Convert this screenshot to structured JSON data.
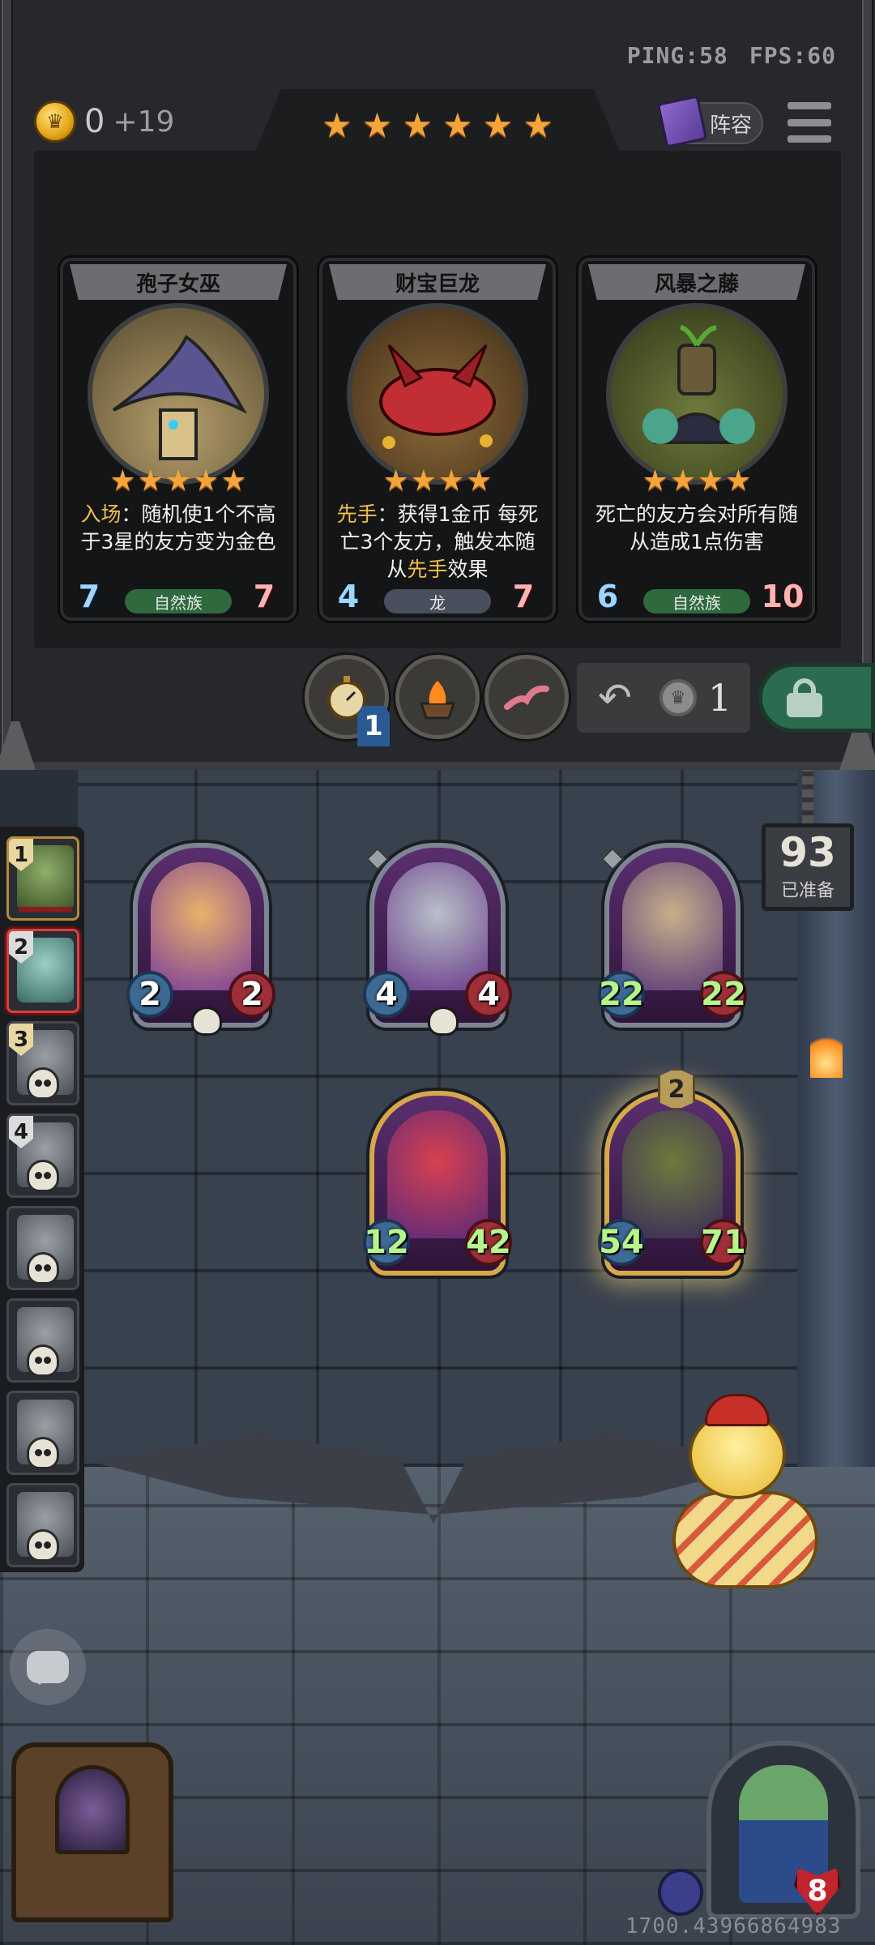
{
  "status": {
    "ping": "PING:58",
    "fps": "FPS:60"
  },
  "gold": {
    "value": "0",
    "income": "+19"
  },
  "tavern_tier_stars": 6,
  "buttons": {
    "lineup": "阵容"
  },
  "shop_cards": [
    {
      "name": "孢子女巫",
      "stars": 5,
      "desc_prefix": "入场",
      "desc_body": "：随机使1个不高于3星的友方变为金色",
      "race": "自然族",
      "attack": "7",
      "health": "7"
    },
    {
      "name": "财宝巨龙",
      "stars": 4,
      "desc_prefix": "先手",
      "desc_body": "：获得1金币 每死亡3个友方，触发本随从",
      "desc_suffix_hl": "先手",
      "desc_suffix": "效果",
      "race": "龙",
      "attack": "4",
      "health": "7"
    },
    {
      "name": "风暴之藤",
      "stars": 4,
      "desc_prefix": "",
      "desc_body": "死亡的友方会对所有随从造成1点伤害",
      "race": "自然族",
      "attack": "6",
      "health": "10"
    }
  ],
  "controls": {
    "timer_badge": "1",
    "refresh_cost": "1"
  },
  "ready": {
    "count": "93",
    "label": "已准备"
  },
  "players": [
    {
      "rank": "1"
    },
    {
      "rank": "2"
    },
    {
      "rank": "3"
    },
    {
      "rank": "4"
    },
    {
      "rank": ""
    },
    {
      "rank": ""
    },
    {
      "rank": ""
    },
    {
      "rank": ""
    }
  ],
  "board": [
    {
      "attack": "2",
      "health": "2"
    },
    {
      "attack": "4",
      "health": "4"
    },
    {
      "attack": "22",
      "health": "22"
    },
    {
      "attack": "12",
      "health": "42"
    },
    {
      "attack": "54",
      "health": "71",
      "level": "2"
    }
  ],
  "hero": {
    "health": "8"
  },
  "coordinate_readout": "1700.43966864983",
  "colors": {
    "star": "#f4a53a",
    "gold_frame": "#d6a84a",
    "active_player": "#d64040"
  }
}
